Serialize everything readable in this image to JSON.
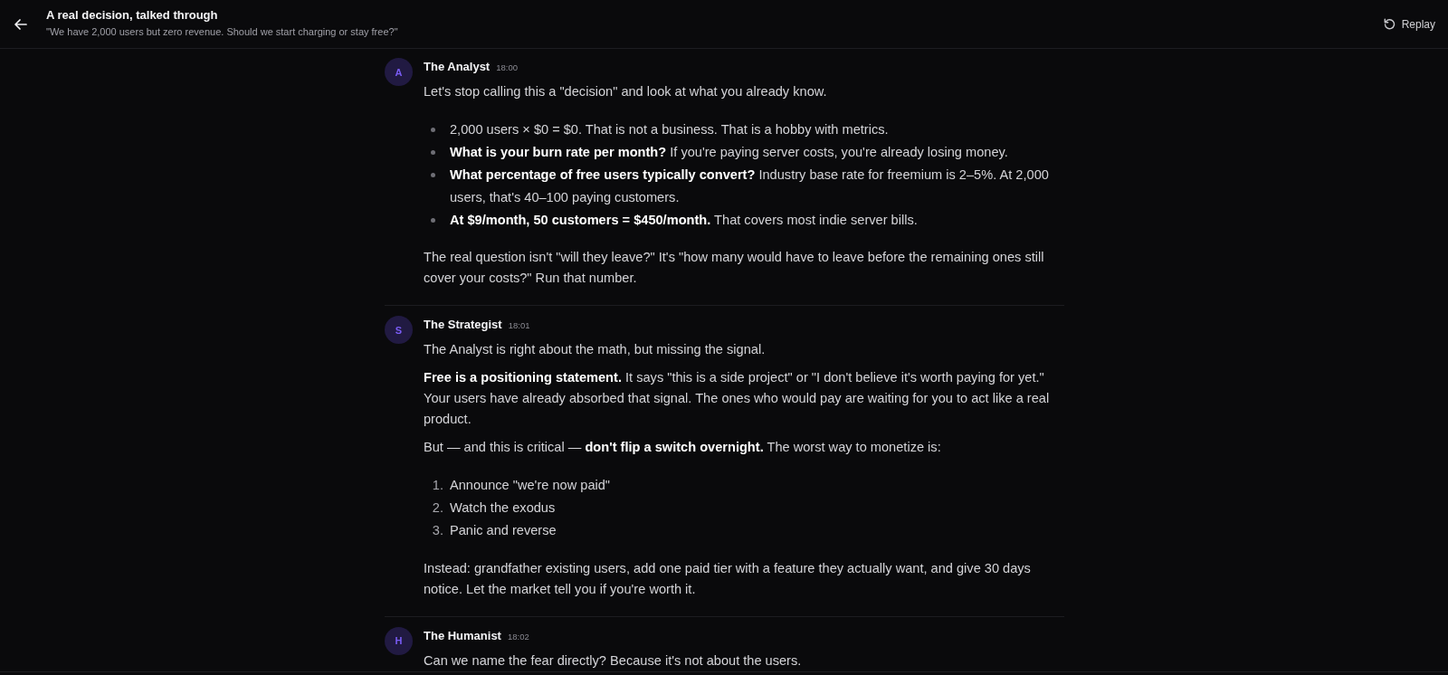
{
  "header": {
    "title": "A real decision, talked through",
    "subtitle": "\"We have 2,000 users but zero revenue. Should we start charging or stay free?\"",
    "action": "Replay"
  },
  "messages": [
    {
      "initial": "A",
      "author": "The Analyst",
      "time": "18:00",
      "blocks": [
        {
          "kind": "paragraph",
          "text": "Let's stop calling this a \"decision\" and look at what you already know."
        },
        {
          "kind": "bullets",
          "items": [
            "2,000 users × $0 = $0. That is not a business. That is a hobby with metrics.",
            "**What is your burn rate per month?** If you're paying server costs, you're already losing money.",
            "**What percentage of free users typically convert?** Industry base rate for freemium is 2–5%. At 2,000 users, that's 40–100 paying customers.",
            "**At $9/month, 50 customers = $450/month.** That covers most indie server bills."
          ]
        },
        {
          "kind": "paragraph",
          "text": "The real question isn't \"will they leave?\" It's \"how many would have to leave before the remaining ones still cover your costs?\" Run that number."
        }
      ]
    },
    {
      "initial": "S",
      "author": "The Strategist",
      "time": "18:01",
      "blocks": [
        {
          "kind": "paragraph",
          "text": "The Analyst is right about the math, but missing the signal."
        },
        {
          "kind": "paragraph",
          "text": "**Free is a positioning statement.** It says \"this is a side project\" or \"I don't believe it's worth paying for yet.\" Your users have already absorbed that signal. The ones who would pay are waiting for you to act like a real product."
        },
        {
          "kind": "paragraph",
          "text": "But — and this is critical — **don't flip a switch overnight.** The worst way to monetize is:"
        },
        {
          "kind": "numbered",
          "items": [
            {
              "number": "1.",
              "text": "Announce \"we're now paid\""
            },
            {
              "number": "2.",
              "text": "Watch the exodus"
            },
            {
              "number": "3.",
              "text": "Panic and reverse"
            }
          ]
        },
        {
          "kind": "paragraph",
          "text": "Instead: grandfather existing users, add one paid tier with a feature they actually want, and give 30 days notice. Let the market tell you if you're worth it."
        }
      ]
    },
    {
      "initial": "H",
      "author": "The Humanist",
      "time": "18:02",
      "blocks": [
        {
          "kind": "paragraph",
          "text": "Can we name the fear directly? Because it's not about the users."
        }
      ]
    }
  ]
}
